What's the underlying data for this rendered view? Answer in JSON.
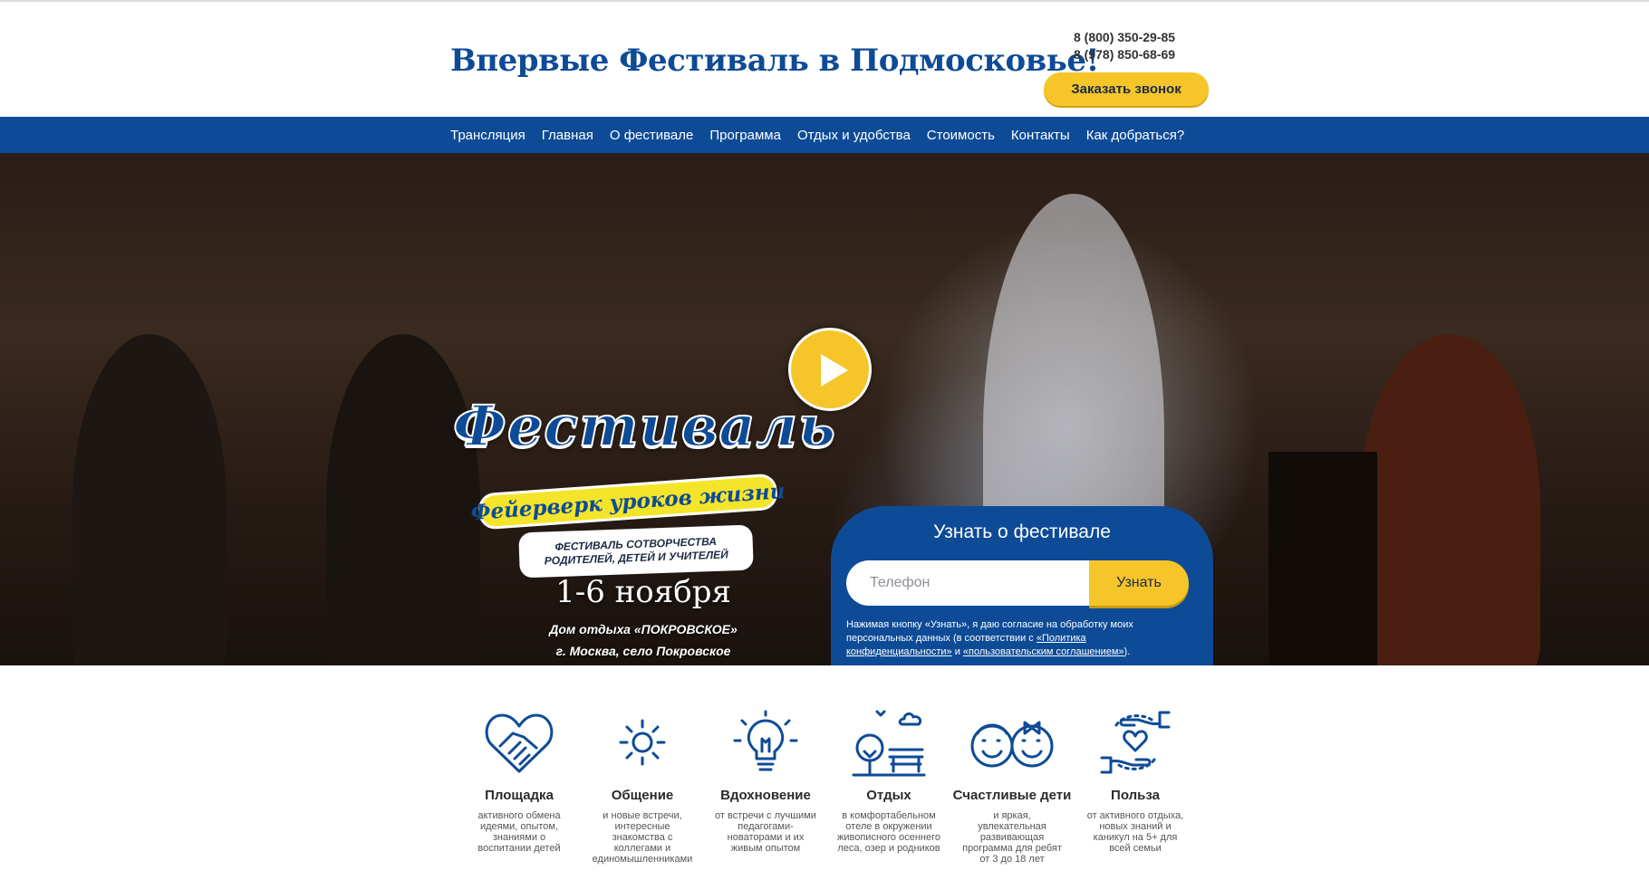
{
  "header": {
    "title": "Впервые Фестиваль в Подмосковье!",
    "phones": [
      "8 (800) 350-29-85",
      "8 (978) 850-68-69"
    ],
    "callback_label": "Заказать звонок"
  },
  "nav": {
    "items": [
      "Трансляция",
      "Главная",
      "О фестивале",
      "Программа",
      "Отдых и удобства",
      "Стоимость",
      "Контакты",
      "Как добраться?"
    ]
  },
  "hero": {
    "logo_title": "Фестиваль",
    "logo_ribbon": "Фейерверк уроков жизни",
    "logo_subtitle": "ФЕСТИВАЛЬ СОТВОРЧЕСТВА РОДИТЕЛЕЙ, ДЕТЕЙ И УЧИТЕЛЕЙ",
    "dates": "1-6 ноября",
    "venue": "Дом отдыха «ПОКРОВСКОЕ»",
    "location": "г. Москва, село Покровское"
  },
  "form": {
    "title": "Узнать о фестивале",
    "phone_placeholder": "Телефон",
    "submit_label": "Узнать",
    "consent_prefix": "Нажимая кнопку «Узнать», я даю согласие на обработку моих персональных данных (в соответствии с ",
    "privacy_link": "«Политика конфиденциальности»",
    "consent_and": " и ",
    "terms_link": "«пользовательским соглашением»",
    "consent_suffix": ")."
  },
  "features": [
    {
      "icon": "handshake-heart-icon",
      "title": "Площадка",
      "text": "активного обмена идеями, опытом, знаниями о воспитании детей"
    },
    {
      "icon": "sun-icon",
      "title": "Общение",
      "text": "и новые встречи, интересные знакомства с коллегами и единомышленниками"
    },
    {
      "icon": "lightbulb-icon",
      "title": "Вдохновение",
      "text": "от встречи с лучшими педагогами-новаторами и их живым опытом"
    },
    {
      "icon": "park-bench-icon",
      "title": "Отдых",
      "text": "в комфортабельном отеле в окружении живописного осеннего леса, озер и родников"
    },
    {
      "icon": "happy-kids-icon",
      "title": "Счастливые дети",
      "text": "и яркая, увлекательная развивающая программа для ребят от 3 до 18 лет"
    },
    {
      "icon": "hands-heart-icon",
      "title": "Польза",
      "text": "от активного отдыха, новых знаний и каникул на 5+ для всей семьи"
    }
  ],
  "colors": {
    "brand_blue": "#0e4b97",
    "accent_yellow": "#f5c52a"
  }
}
